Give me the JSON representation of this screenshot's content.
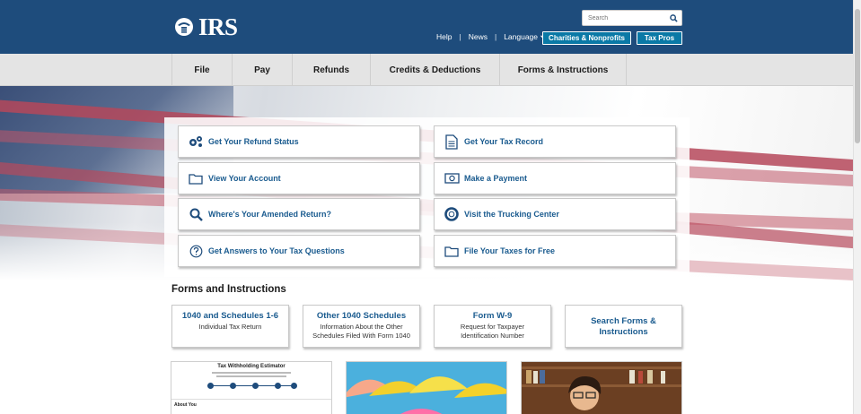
{
  "header": {
    "logo_text": "IRS",
    "search_placeholder": "Search",
    "links": {
      "help": "Help",
      "news": "News",
      "language": "Language"
    },
    "buttons": {
      "charities": "Charities & Nonprofits",
      "tax_pros": "Tax Pros"
    }
  },
  "nav": {
    "items": [
      {
        "label": "File"
      },
      {
        "label": "Pay"
      },
      {
        "label": "Refunds"
      },
      {
        "label": "Credits & Deductions"
      },
      {
        "label": "Forms & Instructions"
      }
    ]
  },
  "tiles": [
    {
      "label": "Get Your Refund Status",
      "icon": "gears-icon"
    },
    {
      "label": "Get Your Tax Record",
      "icon": "document-icon"
    },
    {
      "label": "View Your Account",
      "icon": "folder-icon"
    },
    {
      "label": "Make a Payment",
      "icon": "money-icon"
    },
    {
      "label": "Where's Your Amended Return?",
      "icon": "magnifier-icon"
    },
    {
      "label": "Visit the Trucking Center",
      "icon": "lifebuoy-icon"
    },
    {
      "label": "Get Answers to Your Tax Questions",
      "icon": "question-icon"
    },
    {
      "label": "File Your Taxes for Free",
      "icon": "folder-icon"
    }
  ],
  "forms": {
    "heading": "Forms and Instructions",
    "cards": [
      {
        "title": "1040 and Schedules 1-6",
        "sub": "Individual Tax Return"
      },
      {
        "title": "Other 1040 Schedules",
        "sub": "Information About the Other Schedules Filed With Form 1040"
      },
      {
        "title": "Form W-9",
        "sub": "Request for Taxpayer Identification Number"
      },
      {
        "title": "Search Forms & Instructions",
        "sub": ""
      }
    ]
  },
  "thumbs": {
    "estimator_title": "Tax Withholding Estimator",
    "estimator_section": "About You"
  },
  "colors": {
    "header": "#1e4c7c",
    "link": "#1a5b8f",
    "button": "#0a79a6"
  }
}
